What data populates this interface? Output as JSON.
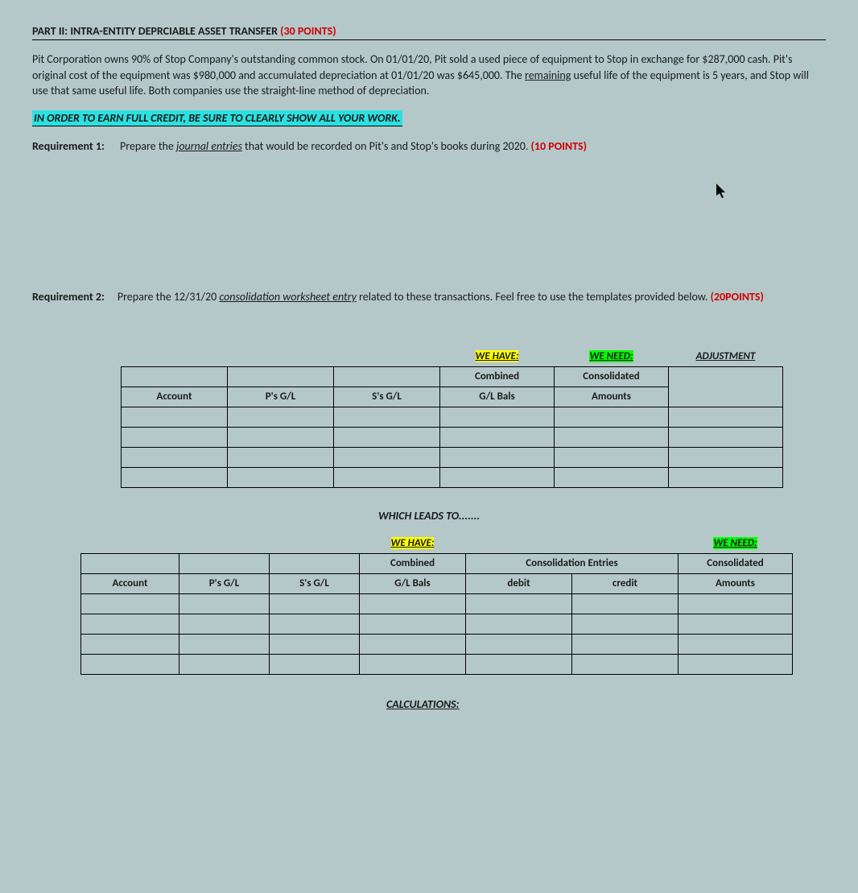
{
  "title": {
    "part": "PART II:",
    "text": "INTRA-ENTITY DEPRCIABLE ASSET TRANSFER",
    "points": "(30 POINTS)"
  },
  "intro": {
    "p1a": "Pit Corporation owns 90% of Stop Company's outstanding common stock.  On 01/01/20, Pit sold a used piece of equipment to Stop in exchange for $287,000 cash.  Pit's original cost of the equipment was $980,000 and accumulated depreciation at 01/01/20 was $645,000.  The ",
    "p1_underline": "remaining",
    "p1b": " useful life of the equipment is 5 years, and Stop will use that same useful life.  Both companies use the straight-line method of depreciation."
  },
  "credit_notice": "IN ORDER TO EARN FULL CREDIT, BE SURE TO CLEARLY SHOW ALL YOUR WORK.",
  "req1": {
    "label": "Requirement 1:",
    "text_a": "Prepare the ",
    "text_u": "journal entries",
    "text_b": " that would be recorded on Pit's and Stop's books during 2020. ",
    "points": "(10 POINTS)"
  },
  "req2": {
    "label": "Requirement 2:",
    "text_a": "Prepare the 12/31/20 ",
    "text_u": "consolidation worksheet entry",
    "text_b": " related to these transactions.  Feel free to use the templates provided below. ",
    "points": "(20POINTS)"
  },
  "table1": {
    "tophdr": {
      "wehave": "WE HAVE:",
      "weneed": "WE NEED:",
      "adj": "ADJUSTMENT"
    },
    "hdr": {
      "account": "Account",
      "pgl": "P's G/L",
      "sgl": "S's G/L",
      "combined1": "Combined",
      "combined2": "G/L Bals",
      "consol1": "Consolidated",
      "consol2": "Amounts"
    }
  },
  "leads": "WHICH LEADS TO.......",
  "table2": {
    "tophdr": {
      "wehave": "WE HAVE:",
      "weneed": "WE NEED:"
    },
    "hdr": {
      "account": "Account",
      "pgl": "P's G/L",
      "sgl": "S's G/L",
      "combined1": "Combined",
      "combined2": "G/L Bals",
      "consolentries": "Consolidation Entries",
      "debit": "debit",
      "credit": "credit",
      "consol1": "Consolidated",
      "consol2": "Amounts"
    }
  },
  "calc": "CALCULATIONS:"
}
